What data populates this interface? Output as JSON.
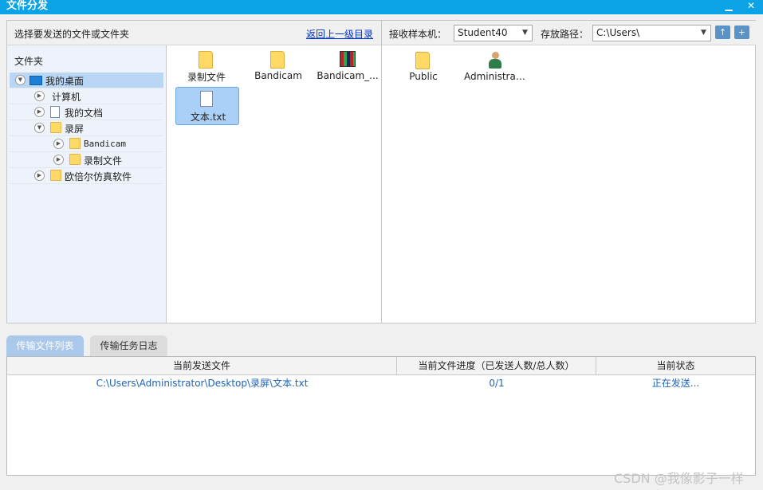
{
  "window": {
    "title": "文件分发",
    "minimize_glyph": "▁",
    "close_glyph": "✕"
  },
  "left_header": {
    "prompt": "选择要发送的文件或文件夹",
    "back_link": "返回上一级目录"
  },
  "right_header": {
    "host_label": "接收样本机：",
    "host_value": "Student40",
    "path_label": "存放路径：",
    "path_value": "C:\\Users\\",
    "up_icon": "folder-up-icon",
    "new_folder_icon": "new-folder-icon"
  },
  "tree": {
    "title": "文件夹",
    "items": [
      {
        "label": "我的桌面",
        "icon": "desktop-icon",
        "toggle": "collapse"
      },
      {
        "label": "计算机",
        "icon": "computer-icon",
        "toggle": "expand"
      },
      {
        "label": "我的文档",
        "icon": "documents-icon",
        "toggle": "expand"
      },
      {
        "label": "录屏",
        "icon": "folder-icon",
        "toggle": "collapse"
      },
      {
        "label": "Bandicam",
        "icon": "folder-icon",
        "toggle": "expand"
      },
      {
        "label": "录制文件",
        "icon": "folder-icon",
        "toggle": "expand"
      },
      {
        "label": "欧倍尔仿真软件",
        "icon": "folder-icon",
        "toggle": "expand"
      }
    ]
  },
  "local_files": [
    {
      "label": "录制文件",
      "icon": "folder-icon"
    },
    {
      "label": "Bandicam",
      "icon": "folder-icon"
    },
    {
      "label": "Bandicam_...",
      "icon": "archive-icon"
    },
    {
      "label": "文本.txt",
      "icon": "text-file-icon",
      "selected": true
    }
  ],
  "remote_files": [
    {
      "label": "Public",
      "icon": "folder-icon"
    },
    {
      "label": "Administrat...",
      "icon": "user-folder-icon"
    }
  ],
  "tabs": [
    {
      "label": "传输文件列表",
      "active": true
    },
    {
      "label": "传输任务日志",
      "active": false
    }
  ],
  "transfer_table": {
    "columns": [
      "当前发送文件",
      "当前文件进度（已发送人数/总人数）",
      "当前状态"
    ],
    "rows": [
      [
        "C:\\Users\\Administrator\\Desktop\\录屏\\文本.txt",
        "0/1",
        "正在发送..."
      ]
    ]
  },
  "watermark": "CSDN @我像影子一样",
  "colors": {
    "titlebar": "#0ba3e6",
    "selection": "#b9d6f5",
    "link": "#0033cc",
    "table_text": "#1e63b8",
    "active_tab": "#a9c8ea"
  }
}
